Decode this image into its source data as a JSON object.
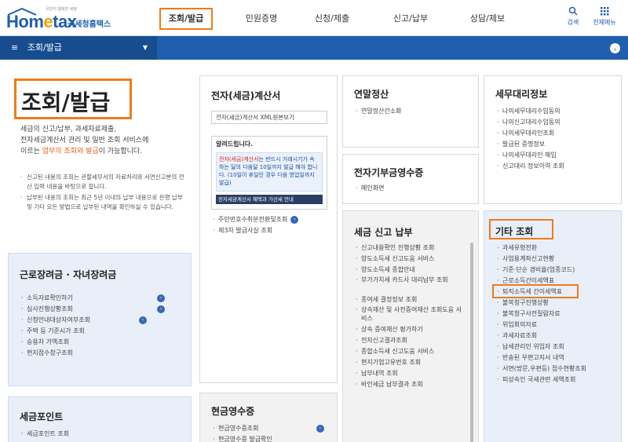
{
  "header": {
    "logo_small": "국민이 행복한 세정",
    "logo_text_a": "Hom",
    "logo_text_e": "e",
    "logo_text_b": "tax",
    "logo_kr": "국세청홈택스",
    "nav": [
      "조회/발급",
      "민원증명",
      "신청/제출",
      "신고/납부",
      "상담/제보"
    ],
    "active_nav": "조회/발급",
    "search_label": "검색",
    "allmenu_label": "전체메뉴"
  },
  "subbar": {
    "breadcrumb": "조회/발급",
    "menu_icon": "hamburger-icon",
    "caret_icon": "chevron-down-icon"
  },
  "page": {
    "title": "조회/발급",
    "intro_1": "세금의 신고/납부, 과세자료제출,",
    "intro_2": "전자세금계산서 관리 및 일반 조회 서비스에",
    "intro_3a": "이르는 ",
    "intro_3b": "업무의 조회와 발급",
    "intro_3c": "이 가능합니다.",
    "note_1": "신고된 내용의 조회는 관할세무서의 자료처리와 서면신고분의 전산 입력 내용을 바탕으로 합니다.",
    "note_2": "납부된 내용의 조회는 최근 5년 이내의 납부 내용으로 은행 납부 및 기타 모든 방법으로 납부된 내역을 확인하실 수 있습니다."
  },
  "cards": {
    "etax": {
      "title": "전자(세금)계산서",
      "pill": "전자(세금)계산서 XML원본보기",
      "notice_title": "알려드립니다.",
      "notice_body_a": "전자(세금)계산서",
      "notice_body_b": "는 반드시 거래시기가 속하는 달의 다음달 10일까지 발급 해야 합니다.",
      "notice_body_c": "(10일이 휴일인 경우 다음 영업일까지 발급)",
      "notice_bar": "전자세금계산서 혜택과 가산세 안내",
      "items": [
        "주민번호수취분전환및조회",
        "제3자 발급사실 조회"
      ]
    },
    "yearend": {
      "title": "연말정산",
      "items": [
        "연말정산간소화"
      ]
    },
    "agent": {
      "title": "세무대리정보",
      "items": [
        "나의세무대리수임동의",
        "나의신고대리수임동의",
        "나의세무대리인조회",
        "발급된 증명정보",
        "나의세무대리인 해임",
        "신고대리 정보이력 조회"
      ]
    },
    "donation": {
      "title": "전자기부금영수증",
      "items": [
        "메인화면"
      ]
    },
    "taxpay": {
      "title": "세금 신고 납부",
      "items": [
        "신고내용확인 진행상황 조회",
        "양도소득세 신고도움 서비스",
        "양도소득세 종합안내",
        "부가가치세 카드사 대리납부 조회",
        "종여세 결정정보 조회",
        "상속재산 및 사전증여재산 조회도움 서비스",
        "상속 증여재산 평가하기",
        "전자신고결과조회",
        "종합소득세 신고도움 서비스",
        "현지기업고유번호 조회",
        "납부내역 조회",
        "바인세금 납부결과 조회"
      ]
    },
    "other": {
      "title": "기타 조회",
      "items": [
        "과세유형전환",
        "사업용계좌신고현황",
        "기준·단순 경비율(업종코드)",
        "근로소득간이세액표",
        "퇴직소득세 간이세액표",
        "불복청구진행상황",
        "불복청구사전질람자료",
        "위임회의자료",
        "과세자료조회",
        "납세관리인 위임자 조회",
        "반송된 우편고지서 내역",
        "서면(방문,우편등) 접수현황조회",
        "피상속인 국세관련 세액조회"
      ],
      "highlighted": "근로소득간이세액표"
    },
    "earned": {
      "title": "근로장려금 · 자녀장려금",
      "items": [
        "소득자료확인하기",
        "심사진행상황조회",
        "신청안내대상자여부조회",
        "주택 등 기준시가 조회",
        "승용차 가액조회",
        "현지점수창구조회"
      ]
    },
    "points": {
      "title": "세금포인트",
      "items": [
        "세금포인트 조회"
      ]
    },
    "cash": {
      "title": "현금영수증",
      "items": [
        "현금영수증조회",
        "현금영수증 발급확인"
      ]
    }
  },
  "colors": {
    "brand_blue": "#1f5fae",
    "highlight_orange": "#f07b1a",
    "light_blue_card": "#e9eff9",
    "gray_card": "#f2f2f2"
  }
}
